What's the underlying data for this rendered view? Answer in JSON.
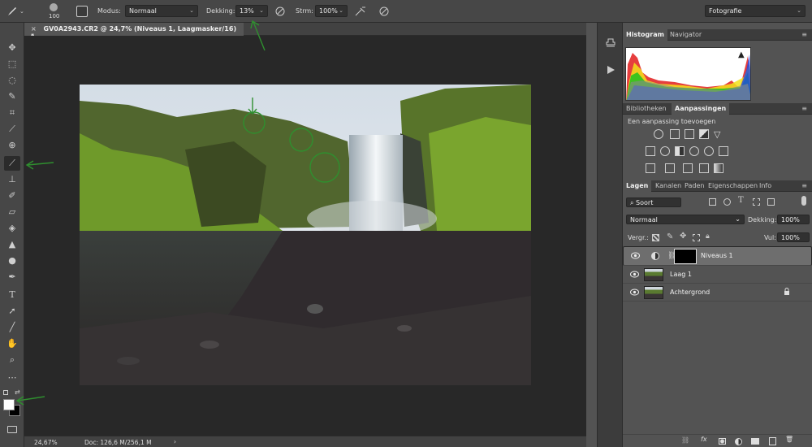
{
  "options_bar": {
    "brush_size": "100",
    "mode_label": "Modus:",
    "mode_value": "Normaal",
    "opacity_label": "Dekking:",
    "opacity_value": "13%",
    "flow_label": "Strm:",
    "flow_value": "100%",
    "workspace": "Fotografie"
  },
  "document": {
    "tab_title": "GV0A2943.CR2 @ 24,7% (Niveaus 1, Laagmasker/16) *",
    "close_glyph": "×"
  },
  "status": {
    "zoom": "24,67%",
    "doc_info": "Doc: 126,6 M/256,1 M",
    "arrow": "›"
  },
  "panels": {
    "histogram_tabs": [
      "Histogram",
      "Navigator"
    ],
    "library_tabs": [
      "Bibliotheken",
      "Aanpassingen"
    ],
    "adjustments_title": "Een aanpassing toevoegen",
    "layers_tabs": [
      "Lagen",
      "Kanalen",
      "Paden",
      "Eigenschappen",
      "Info"
    ],
    "filter_label": "Soort",
    "blend_mode": "Normaal",
    "opacity_label": "Dekking:",
    "opacity_value": "100%",
    "lock_label": "Vergr.:",
    "fill_label": "Vul:",
    "fill_value": "100%",
    "layers": [
      {
        "name": "Niveaus 1"
      },
      {
        "name": "Laag 1"
      },
      {
        "name": "Achtergrond"
      }
    ]
  },
  "icons": {
    "brush": "brush-icon",
    "move": "move-icon",
    "eye": "eye-icon",
    "lock": "lock-icon",
    "warning": "warning-icon"
  },
  "colors": {
    "annotation_arrow": "#2f8f2f",
    "panel_bg": "#535353",
    "canvas_bg": "#282828"
  }
}
